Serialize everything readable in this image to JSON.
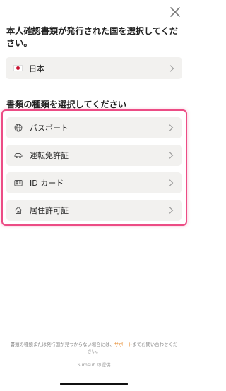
{
  "heading": "本人確認書類が発行された国を選択してください。",
  "country": {
    "flag_icon": "japan-flag-icon",
    "label": "日本"
  },
  "section_title": "書類の種類を選択してください",
  "document_types": [
    {
      "icon": "globe-icon",
      "label": "パスポート"
    },
    {
      "icon": "car-icon",
      "label": "運転免許証"
    },
    {
      "icon": "id-card-icon",
      "label": "ID カード"
    },
    {
      "icon": "home-icon",
      "label": "居住許可証"
    }
  ],
  "footer": {
    "note_before": "書類の種類または発行国が見つからない場合には、",
    "support_link": "サポート",
    "note_after": "までお問い合わせください。",
    "powered_by": "Sumsub の提供"
  },
  "colors": {
    "highlight": "#ec4c85",
    "link": "#e6882a",
    "item_bg": "#f2f1ef"
  }
}
